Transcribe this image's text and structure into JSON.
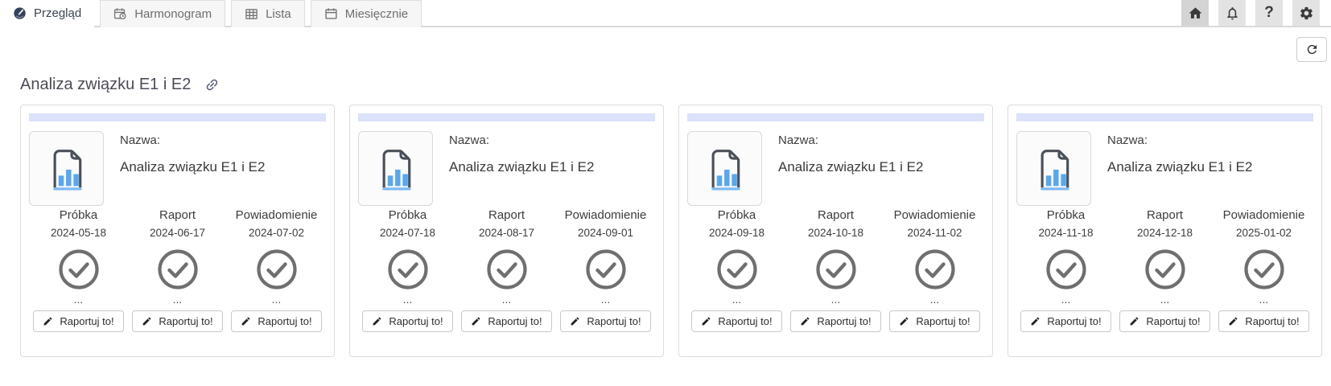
{
  "header": {
    "tabs": [
      {
        "label": "Przegląd",
        "icon": "gauge-icon",
        "active": true
      },
      {
        "label": "Harmonogram",
        "icon": "calendar-clock-icon",
        "active": false
      },
      {
        "label": "Lista",
        "icon": "table-icon",
        "active": false
      },
      {
        "label": "Miesięcznie",
        "icon": "calendar-icon",
        "active": false
      }
    ],
    "action_icons": [
      "home-icon",
      "bell-icon",
      "help-icon",
      "gear-icon"
    ],
    "help_glyph": "?"
  },
  "toolbar": {
    "refresh_icon": "refresh-icon"
  },
  "page": {
    "title": "Analiza związku E1 i E2",
    "title_link_icon": "link-icon"
  },
  "cards": [
    {
      "name_label": "Nazwa:",
      "name": "Analiza związku E1 i E2",
      "milestones": [
        {
          "label": "Próbka",
          "date": "2024-05-18",
          "status_icon": "check-circle-icon",
          "more": "...",
          "action": "Raportuj to!"
        },
        {
          "label": "Raport",
          "date": "2024-06-17",
          "status_icon": "check-circle-icon",
          "more": "...",
          "action": "Raportuj to!"
        },
        {
          "label": "Powiadomienie",
          "date": "2024-07-02",
          "status_icon": "check-circle-icon",
          "more": "...",
          "action": "Raportuj to!"
        }
      ]
    },
    {
      "name_label": "Nazwa:",
      "name": "Analiza związku E1 i E2",
      "milestones": [
        {
          "label": "Próbka",
          "date": "2024-07-18",
          "status_icon": "check-circle-icon",
          "more": "...",
          "action": "Raportuj to!"
        },
        {
          "label": "Raport",
          "date": "2024-08-17",
          "status_icon": "check-circle-icon",
          "more": "...",
          "action": "Raportuj to!"
        },
        {
          "label": "Powiadomienie",
          "date": "2024-09-01",
          "status_icon": "check-circle-icon",
          "more": "...",
          "action": "Raportuj to!"
        }
      ]
    },
    {
      "name_label": "Nazwa:",
      "name": "Analiza związku E1 i E2",
      "milestones": [
        {
          "label": "Próbka",
          "date": "2024-09-18",
          "status_icon": "check-circle-icon",
          "more": "...",
          "action": "Raportuj to!"
        },
        {
          "label": "Raport",
          "date": "2024-10-18",
          "status_icon": "check-circle-icon",
          "more": "...",
          "action": "Raportuj to!"
        },
        {
          "label": "Powiadomienie",
          "date": "2024-11-02",
          "status_icon": "check-circle-icon",
          "more": "...",
          "action": "Raportuj to!"
        }
      ]
    },
    {
      "name_label": "Nazwa:",
      "name": "Analiza związku E1 i E2",
      "milestones": [
        {
          "label": "Próbka",
          "date": "2024-11-18",
          "status_icon": "check-circle-icon",
          "more": "...",
          "action": "Raportuj to!"
        },
        {
          "label": "Raport",
          "date": "2024-12-18",
          "status_icon": "check-circle-icon",
          "more": "...",
          "action": "Raportuj to!"
        },
        {
          "label": "Powiadomienie",
          "date": "2025-01-02",
          "status_icon": "check-circle-icon",
          "more": "...",
          "action": "Raportuj to!"
        }
      ]
    }
  ],
  "colors": {
    "progress_bar": "#dbe2f9",
    "chart_blue": "#58a7f0",
    "check_gray": "#6f6f6f",
    "tab_active_text": "#3b4452"
  }
}
